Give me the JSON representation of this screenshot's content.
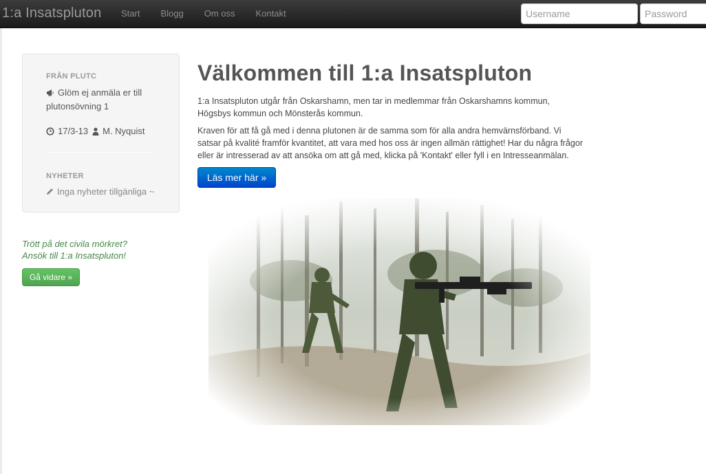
{
  "navbar": {
    "brand": "1:a Insatspluton",
    "links": [
      "Start",
      "Blogg",
      "Om oss",
      "Kontakt"
    ],
    "username_placeholder": "Username",
    "password_placeholder": "Password"
  },
  "sidebar": {
    "plutc_header": "FRÅN PLUTC",
    "message": "Glöm ej anmäla er till plutonsövning 1",
    "date": "17/3-13",
    "author": "M. Nyquist",
    "news_header": "NYHETER",
    "news_empty": "Inga nyheter tillgänliga ~",
    "cta_line1": "Trött på det civila mörkret?",
    "cta_line2": "Ansök till 1:a Insatspluton!",
    "cta_button": "Gå vidare »"
  },
  "main": {
    "title": "Välkommen till 1:a Insatspluton",
    "paragraph1": "1:a Insatspluton utgår från Oskarshamn, men tar in medlemmar från Oskarshamns kommun, Högsbys kommun och Mönsterås kommun.",
    "paragraph2": "Kraven för att få gå med i denna plutonen är de samma som för alla andra hemvärnsförband. Vi satsar på kvalité framför kvantitet, att vara med hos oss är ingen allmän rättighet! Har du några frågor eller är intresserad av att ansöka om att gå med, klicka på 'Kontakt' eller fyll i en Intresseanmälan.",
    "read_more_button": "Läs mer här »"
  },
  "icons": {
    "megaphone": "bullhorn-icon",
    "clock": "clock-icon",
    "user": "user-icon",
    "pencil": "pencil-icon"
  },
  "colors": {
    "navbar_dark": "#1b1b1b",
    "primary_button": "#0055cc",
    "success_button": "#51a351",
    "cta_text": "#468847"
  }
}
